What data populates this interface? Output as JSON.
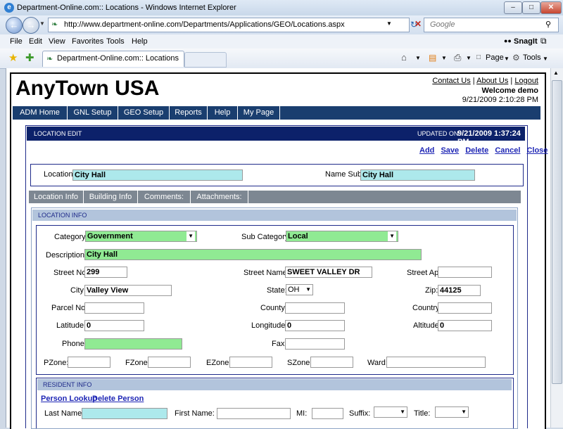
{
  "browser": {
    "window_title": "Department-Online.com:: Locations - Windows Internet Explorer",
    "url": "http://www.department-online.com/Departments/Applications/GEO/Locations.aspx",
    "search_placeholder": "Google",
    "menu": [
      "File",
      "Edit",
      "View",
      "Favorites",
      "Tools",
      "Help"
    ],
    "snagit_label": "SnagIt",
    "tab_title": "Department-Online.com:: Locations",
    "page_menu": "Page",
    "tools_menu": "Tools"
  },
  "site": {
    "brand": "AnyTown USA",
    "contact": "Contact Us",
    "about": "About Us",
    "logout": "Logout",
    "sep": "|",
    "welcome": "Welcome demo",
    "datetime": "9/21/2009 2:10:28 PM",
    "nav": [
      "ADM Home",
      "GNL Setup",
      "GEO Setup",
      "Reports",
      "Help",
      "My Page"
    ]
  },
  "edit": {
    "header": "LOCATION EDIT",
    "updated_label": "UPDATED ON:",
    "updated_value": "9/21/2009 1:37:24 PM",
    "actions": [
      "Add",
      "Save",
      "Delete",
      "Cancel",
      "Close"
    ],
    "location_label": "Location:",
    "location_value": "City Hall",
    "namesub_label": "Name Sub:",
    "namesub_value": "City Hall",
    "tabs": [
      "Location Info",
      "Building Info",
      "Comments:",
      "Attachments:"
    ]
  },
  "location_info": {
    "title": "LOCATION INFO",
    "category_label": "Category:",
    "category_value": "Government",
    "subcategory_label": "Sub Category:",
    "subcategory_value": "Local",
    "description_label": "Description:",
    "description_value": "City Hall",
    "street_no_label": "Street No:",
    "street_no_value": "299",
    "street_name_label": "Street Name:",
    "street_name_value": "SWEET VALLEY DR",
    "street_apt_label": "Street Apt:",
    "street_apt_value": "",
    "city_label": "City:",
    "city_value": "Valley View",
    "state_label": "State:",
    "state_value": "OH",
    "zip_label": "Zip:",
    "zip_value": "44125",
    "parcel_label": "Parcel No:",
    "parcel_value": "",
    "county_label": "County:",
    "county_value": "",
    "country_label": "Country:",
    "country_value": "",
    "latitude_label": "Latitude:",
    "latitude_value": "0",
    "longitude_label": "Longitude:",
    "longitude_value": "0",
    "altitude_label": "Altitude:",
    "altitude_value": "0",
    "phone_label": "Phone:",
    "phone_value": "",
    "fax_label": "Fax:",
    "fax_value": "",
    "pzone_label": "PZone:",
    "fzone_label": "FZone:",
    "ezone_label": "EZone:",
    "szone_label": "SZone:",
    "ward_label": "Ward:"
  },
  "resident_info": {
    "title": "RESIDENT INFO",
    "person_lookup": "Person Lookup",
    "delete_person": "Delete Person",
    "last_name_label": "Last Name:",
    "first_name_label": "First Name:",
    "mi_label": "MI:",
    "suffix_label": "Suffix:",
    "title_label": "Title:"
  }
}
